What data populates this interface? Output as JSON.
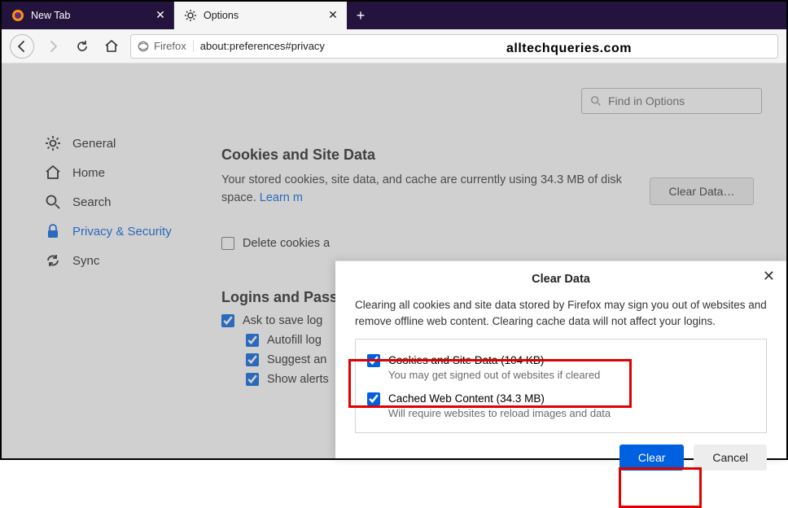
{
  "tabs": [
    {
      "title": "New Tab",
      "active": false
    },
    {
      "title": "Options",
      "active": true
    }
  ],
  "urlbar": {
    "identity": "Firefox",
    "path": "about:preferences#privacy"
  },
  "watermark": "alltechqueries.com",
  "find_placeholder": "Find in Options",
  "sidebar": {
    "items": [
      {
        "label": "General",
        "icon": "gear-icon"
      },
      {
        "label": "Home",
        "icon": "home-icon"
      },
      {
        "label": "Search",
        "icon": "search-icon"
      },
      {
        "label": "Privacy & Security",
        "icon": "lock-icon",
        "selected": true
      },
      {
        "label": "Sync",
        "icon": "sync-icon"
      }
    ]
  },
  "section_cookies": {
    "heading": "Cookies and Site Data",
    "body_prefix": "Your stored cookies, site data, and cache are currently using 34.3 MB of disk space.  ",
    "learn_more": "Learn m",
    "delete_cb_label": "Delete cookies a",
    "clear_data_btn": "Clear Data…"
  },
  "section_logins": {
    "heading": "Logins and Passw",
    "cb1": "Ask to save log",
    "cb2": "Autofill log",
    "cb3": "Suggest an",
    "cb4": "Show alerts"
  },
  "dialog": {
    "title": "Clear Data",
    "desc": "Clearing all cookies and site data stored by Firefox may sign you out of websites and remove offline web content. Clearing cache data will not affect your logins.",
    "opt1_label_pre": "Cookies and ",
    "opt1_label_u": "S",
    "opt1_label_post": "ite Data (104 KB)",
    "opt1_sub": "You may get signed out of websites if cleared",
    "opt2_label_pre": "Cached ",
    "opt2_label_u": "W",
    "opt2_label_post": "eb Content (34.3 MB)",
    "opt2_sub": "Will require websites to reload images and data",
    "btn_clear_pre": "C",
    "btn_clear_u": "l",
    "btn_clear_post": "ear",
    "btn_cancel": "Cancel"
  }
}
